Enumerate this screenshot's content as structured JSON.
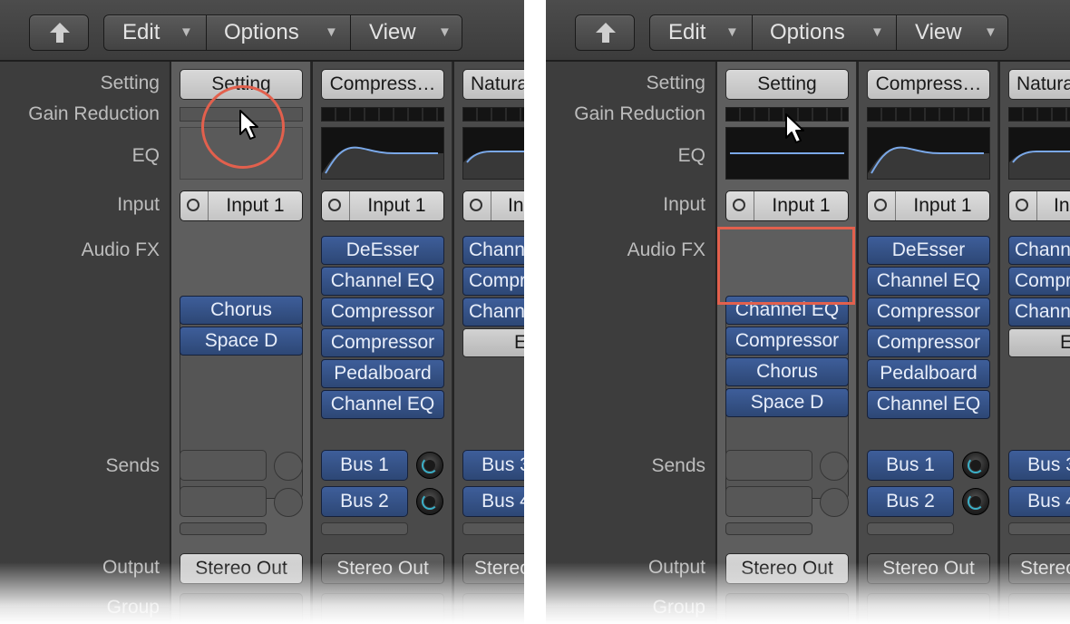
{
  "toolbar": {
    "edit": "Edit",
    "options": "Options",
    "view": "View",
    "arrow": "▼"
  },
  "labels": {
    "setting": "Setting",
    "gain_reduction": "Gain Reduction",
    "eq": "EQ",
    "input": "Input",
    "audio_fx": "Audio FX",
    "sends": "Sends",
    "output": "Output",
    "group": "Group"
  },
  "left_panel": {
    "strip1": {
      "setting": "Setting",
      "input": "Input 1",
      "fx": [
        "Chorus",
        "Space D"
      ],
      "output": "Stereo Out"
    },
    "strip2": {
      "setting": "Compress…",
      "input": "Input 1",
      "fx": [
        "DeEsser",
        "Channel EQ",
        "Compressor",
        "Compressor",
        "Pedalboard",
        "Channel EQ"
      ],
      "sends": [
        "Bus 1",
        "Bus 2"
      ],
      "output": "Stereo Out"
    },
    "strip3": {
      "setting": "Natura",
      "input": "In",
      "fx": [
        "Chann",
        "Compr",
        "Chann",
        "Ec"
      ],
      "sends": [
        "Bus 3",
        "Bus 4"
      ],
      "output": "Stereo"
    }
  },
  "right_panel": {
    "strip1": {
      "setting": "Setting",
      "input": "Input 1",
      "fx": [
        "Channel EQ",
        "Compressor",
        "Chorus",
        "Space D"
      ],
      "output": "Stereo Out"
    },
    "strip2": {
      "setting": "Compress…",
      "input": "Input 1",
      "fx": [
        "DeEsser",
        "Channel EQ",
        "Compressor",
        "Compressor",
        "Pedalboard",
        "Channel EQ"
      ],
      "sends": [
        "Bus 1",
        "Bus 2"
      ],
      "output": "Stereo Out"
    },
    "strip3": {
      "setting": "Natura",
      "input": "In",
      "fx": [
        "Chann",
        "Compr",
        "Chann",
        "Ec"
      ],
      "sends": [
        "Bus 3",
        "Bus 4"
      ],
      "output": "Stereo"
    }
  },
  "colors": {
    "plugin_blue": "#3a5a94",
    "highlight": "#e2604d",
    "eq_curve": "#7aa8e8",
    "knob_ring": "#3bb0c8"
  },
  "icons": {
    "up": "up-arrow-icon",
    "cursor": "mouse-pointer-icon"
  }
}
